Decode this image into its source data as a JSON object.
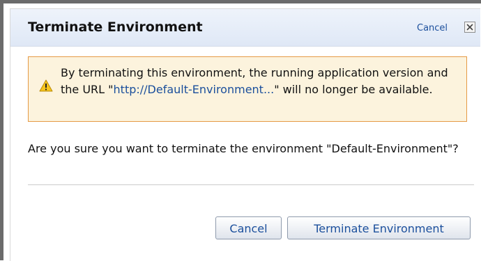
{
  "dialog": {
    "title": "Terminate Environment",
    "cancel_link": "Cancel",
    "close_icon": "close-x-icon"
  },
  "warning": {
    "icon": "warning-triangle-icon",
    "text_before_link": "By terminating this environment, the running application version and the URL \"",
    "link_text": "http://Default-Environment...",
    "text_after_link": "\" will no longer be available."
  },
  "question": "Are you sure you want to terminate the environment \"Default-Environment\"?",
  "buttons": {
    "cancel_label": "Cancel",
    "terminate_label": "Terminate Environment"
  },
  "colors": {
    "link": "#1b4f9c",
    "warning_background": "#fcf3dd",
    "warning_border": "#e59a45",
    "header_background": "#dfe8f6"
  }
}
